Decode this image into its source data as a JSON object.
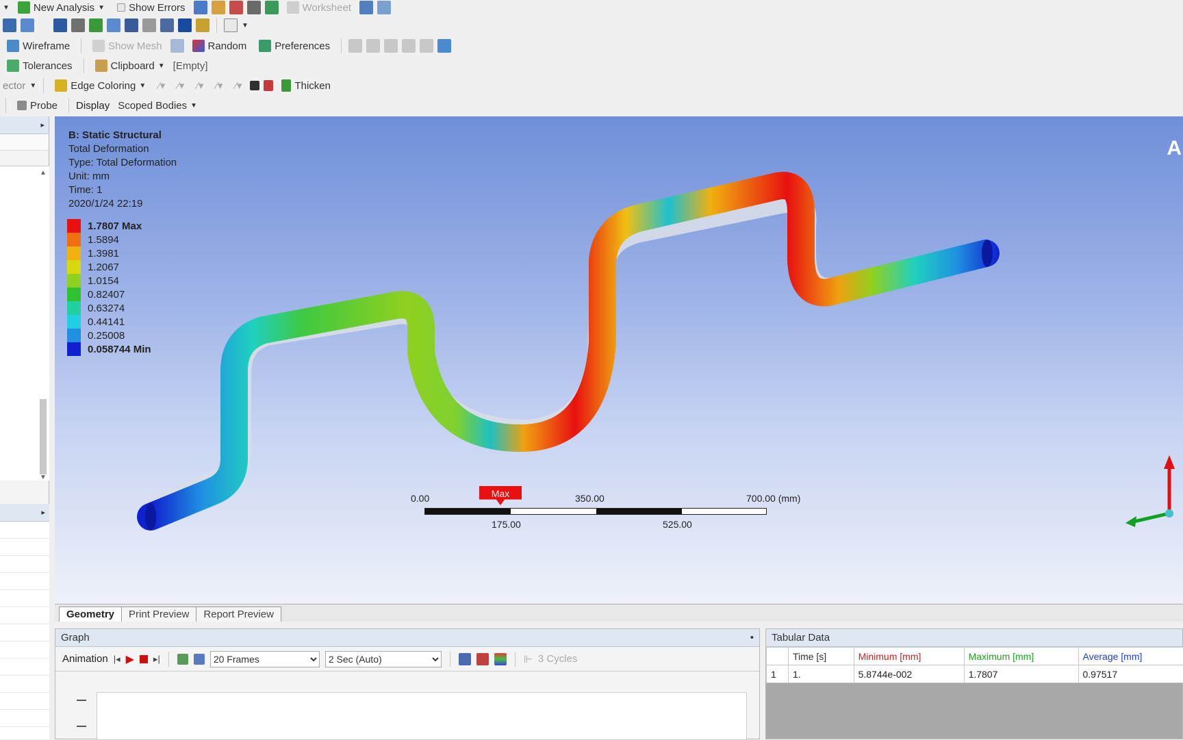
{
  "toolbar1": {
    "new_analysis": "New Analysis",
    "show_errors": "Show Errors",
    "worksheet": "Worksheet"
  },
  "toolbar3": {
    "wireframe": "Wireframe",
    "show_mesh": "Show Mesh",
    "random": "Random",
    "preferences": "Preferences"
  },
  "toolbar4": {
    "tolerances": "Tolerances",
    "clipboard": "Clipboard",
    "clipboard_state": "[Empty]"
  },
  "toolbar5": {
    "vector_fragment": "ector",
    "edge_coloring": "Edge Coloring",
    "thicken": "Thicken"
  },
  "toolbar6": {
    "probe": "Probe",
    "display_label": "Display",
    "display_value": "Scoped Bodies"
  },
  "viewport": {
    "info_lines": [
      "B: Static Structural",
      "Total Deformation",
      "Type: Total Deformation",
      "Unit: mm",
      "Time: 1",
      "2020/1/24 22:19"
    ],
    "legend": [
      {
        "value": "1.7807 Max",
        "color": "#e81010"
      },
      {
        "value": "1.5894",
        "color": "#f07010"
      },
      {
        "value": "1.3981",
        "color": "#f0b010"
      },
      {
        "value": "1.2067",
        "color": "#d8d810"
      },
      {
        "value": "1.0154",
        "color": "#90d020"
      },
      {
        "value": "0.82407",
        "color": "#30c030"
      },
      {
        "value": "0.63274",
        "color": "#20d0a0"
      },
      {
        "value": "0.44141",
        "color": "#20d0e0"
      },
      {
        "value": "0.25008",
        "color": "#2090e0"
      },
      {
        "value": "0.058744 Min",
        "color": "#1020d0"
      }
    ],
    "max_probe": "Max",
    "corner_letter": "A",
    "scale": {
      "top_labels": [
        "0.00",
        "350.00",
        "700.00 (mm)"
      ],
      "bottom_labels": [
        "175.00",
        "525.00"
      ]
    }
  },
  "tabs": [
    "Geometry",
    "Print Preview",
    "Report Preview"
  ],
  "graph": {
    "title": "Graph",
    "pin": "•",
    "animation_label": "Animation",
    "frames": "20 Frames",
    "speed": "2 Sec (Auto)",
    "cycles": "3 Cycles"
  },
  "tabular": {
    "title": "Tabular Data",
    "headers": [
      "",
      "Time [s]",
      "Minimum [mm]",
      "Maximum [mm]",
      "Average [mm]"
    ],
    "rows": [
      [
        "1",
        "1.",
        "5.8744e-002",
        "1.7807",
        "0.97517"
      ]
    ],
    "header_colors": [
      "#333333",
      "#333333",
      "#d02020",
      "#20a020",
      "#2040d0"
    ]
  }
}
